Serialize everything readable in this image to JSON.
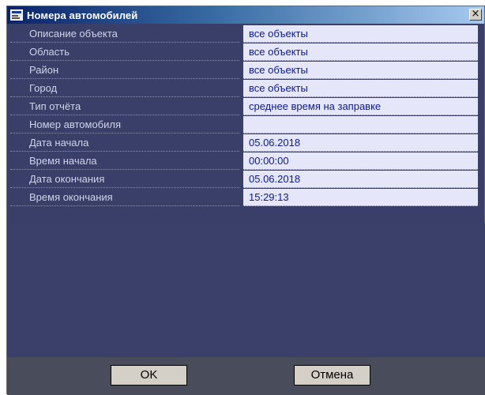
{
  "window": {
    "title": "Номера автомобилей",
    "close_glyph": "×"
  },
  "rows": [
    {
      "label": "Описание объекта",
      "value": "все объекты"
    },
    {
      "label": "Область",
      "value": "все объекты"
    },
    {
      "label": "Район",
      "value": "все объекты"
    },
    {
      "label": "Город",
      "value": "все объекты"
    },
    {
      "label": "Тип отчёта",
      "value": "среднее время на заправке"
    },
    {
      "label": "Номер автомобиля",
      "value": ""
    },
    {
      "label": "Дата начала",
      "value": "05.06.2018"
    },
    {
      "label": "Время начала",
      "value": "00:00:00"
    },
    {
      "label": "Дата окончания",
      "value": "05.06.2018"
    },
    {
      "label": "Время окончания",
      "value": "15:29:13"
    }
  ],
  "buttons": {
    "ok": "OK",
    "cancel": "Отмена"
  }
}
